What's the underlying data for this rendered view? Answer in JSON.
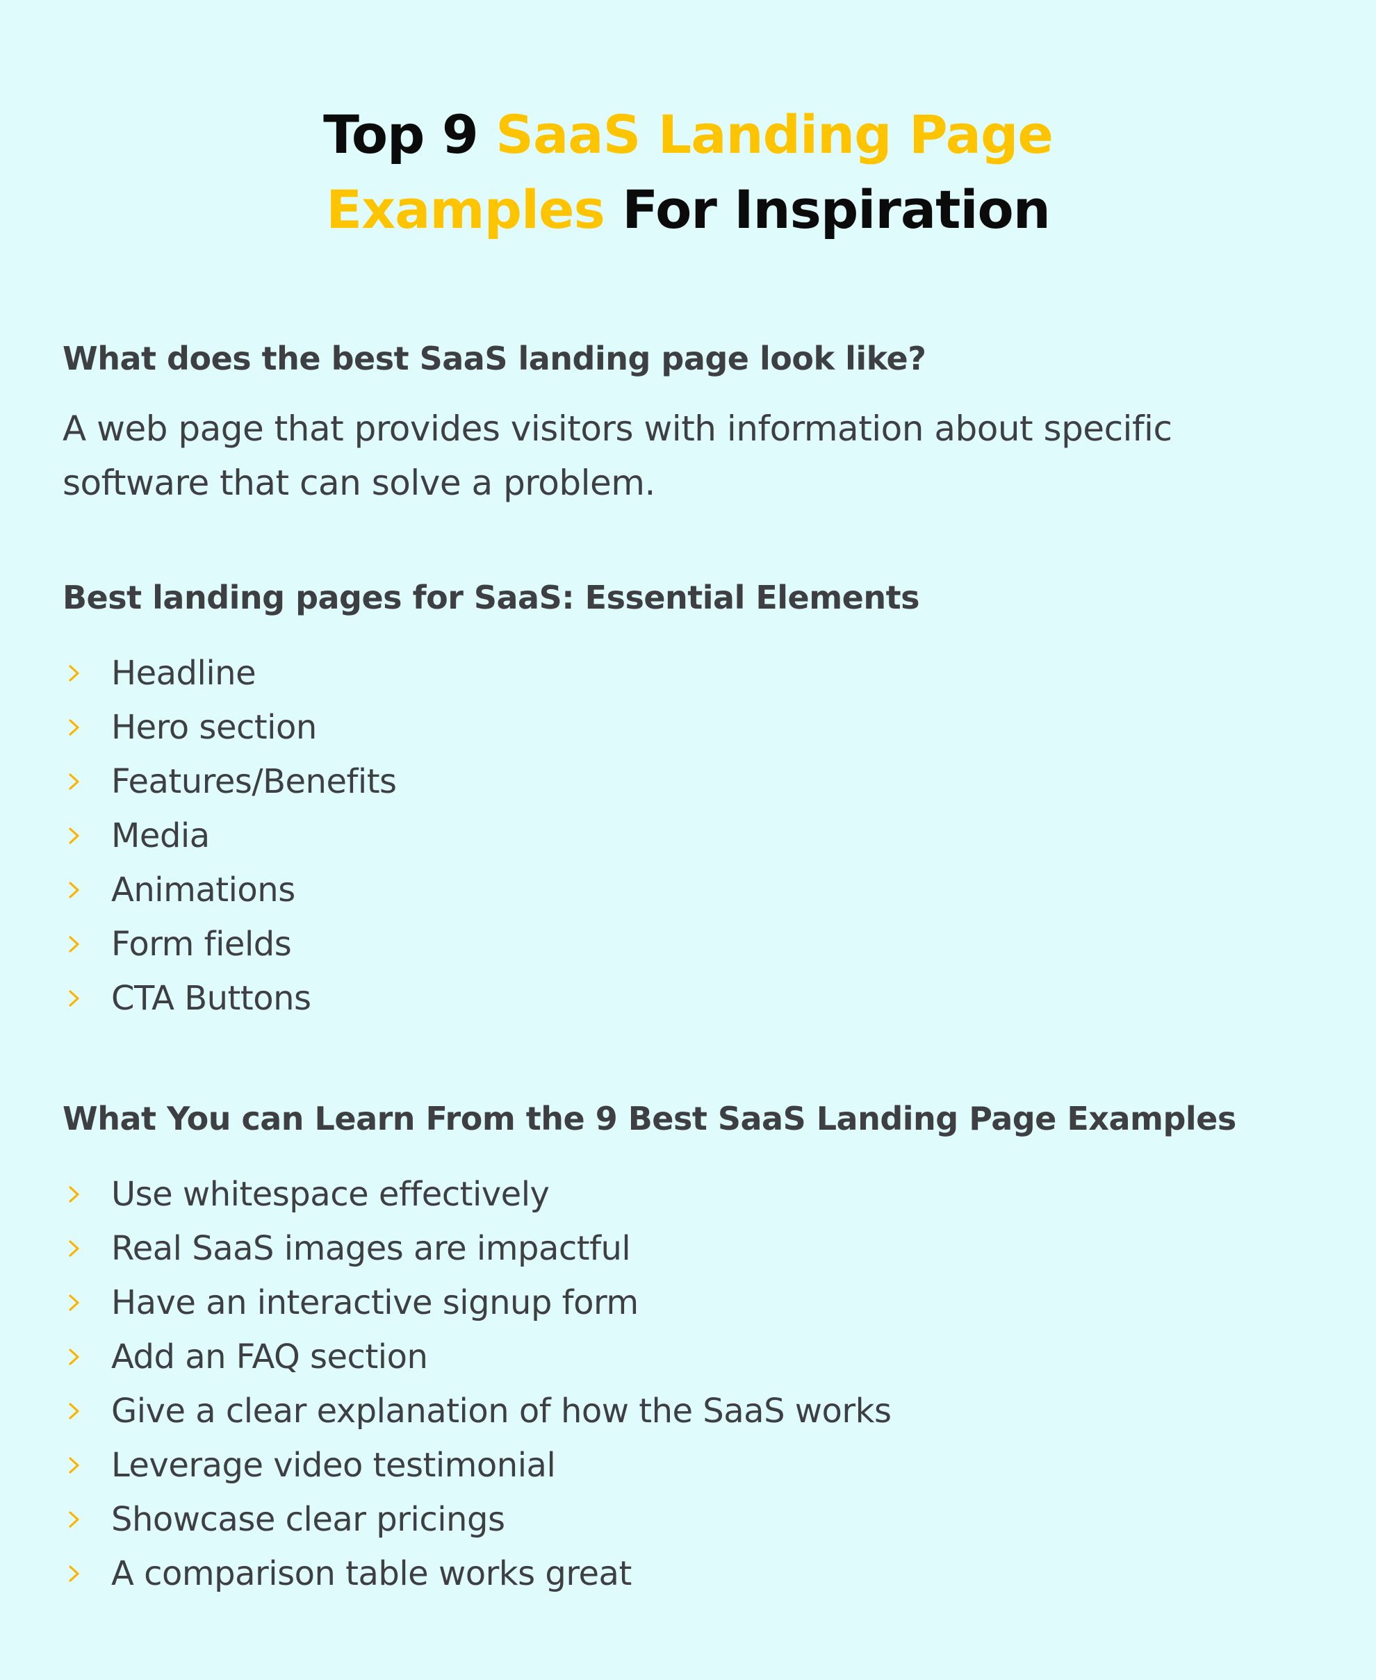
{
  "title": {
    "part1": "Top 9 ",
    "part2_accent": "SaaS Landing Page",
    "part3_accent": "Examples",
    "part4": " For Inspiration"
  },
  "colors": {
    "background": "#e0fbfc",
    "accent": "#ffc400",
    "title_text": "#0b0b0b",
    "body_text": "#3d3f42",
    "bullet": "#ffb300"
  },
  "sections": [
    {
      "heading": "What does the best SaaS landing page look like?",
      "description": "A web page that provides visitors with information about specific software that can solve a problem."
    },
    {
      "heading": "Best landing pages for SaaS: Essential Elements",
      "items": [
        "Headline",
        "Hero section",
        "Features/Benefits",
        "Media",
        "Animations",
        "Form fields",
        "CTA Buttons"
      ]
    },
    {
      "heading": "What You can Learn From the 9 Best SaaS Landing Page Examples",
      "items": [
        "Use whitespace effectively",
        "Real SaaS images are impactful",
        "Have an interactive signup form",
        "Add an FAQ section",
        "Give a clear explanation of how the SaaS works",
        "Leverage video testimonial",
        "Showcase clear pricings",
        "A comparison table works great"
      ]
    }
  ],
  "icons": {
    "bullet": "chevron-right-icon"
  }
}
